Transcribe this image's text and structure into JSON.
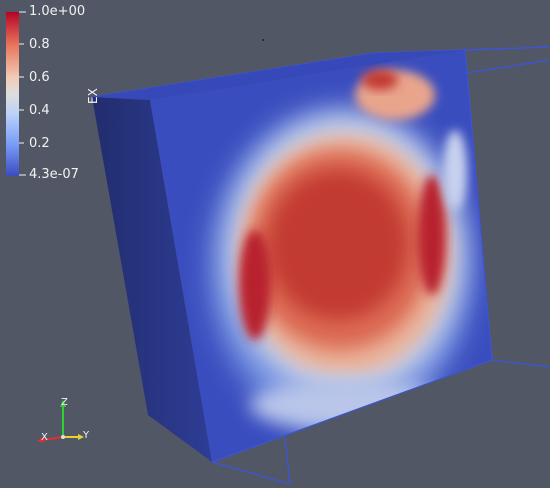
{
  "colorbar": {
    "title": "EX",
    "ticks": [
      "1.0e+00",
      "0.8",
      "0.6",
      "0.4",
      "0.2",
      "4.3e-07"
    ],
    "colors": {
      "high": "#b40426",
      "mid": "#dddddd",
      "low": "#3b4cc0"
    }
  },
  "orientation_axes": {
    "x_label": "X",
    "y_label": "Y",
    "z_label": "Z",
    "x_color": "#e03030",
    "y_color": "#e8d030",
    "z_color": "#30d030"
  },
  "scene": {
    "background": "#525766",
    "outline_color": "#3a55e0",
    "object_base_color": "#3a4dbe"
  }
}
